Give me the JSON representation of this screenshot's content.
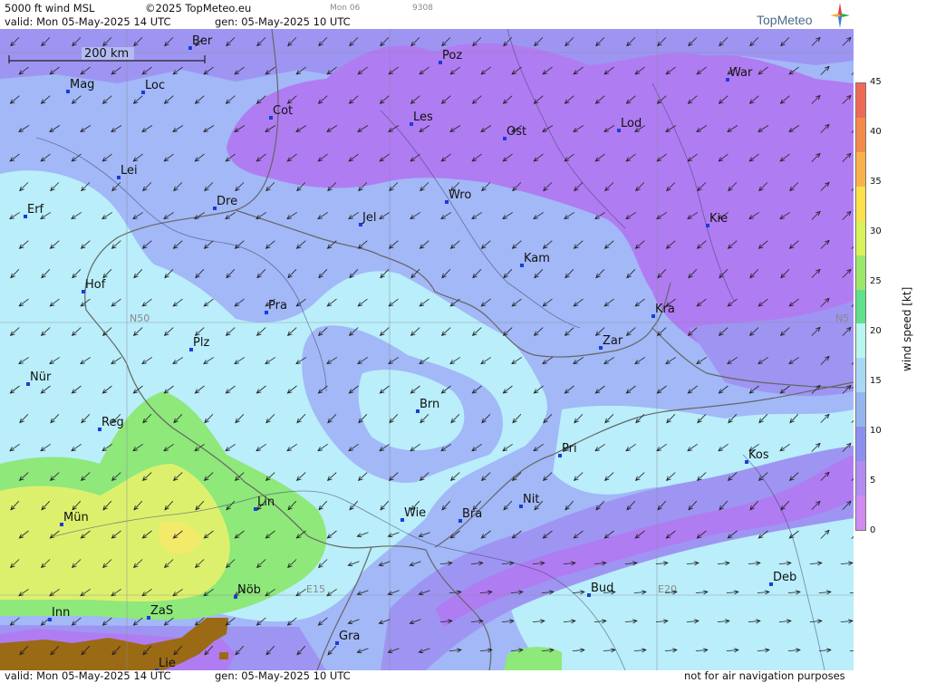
{
  "header": {
    "product": "5000 ft wind MSL",
    "copyright": "©2025 TopMeteo.eu",
    "valid_line": "valid:  Mon  05-May-2025  14 UTC",
    "gen_line": "gen:  05-May-2025 10 UTC",
    "faint_day": "Mon 06",
    "faint_code": "9308",
    "brand": "TopMeteo"
  },
  "footer": {
    "valid_line": "valid:  Mon  05-May-2025  14 UTC",
    "gen_line": "gen:  05-May-2025 10 UTC",
    "disclaimer": "not for air navigation purposes"
  },
  "scale_bar": {
    "label": "200 km"
  },
  "grid_labels": {
    "lat": "N50",
    "lat_right": "N5",
    "lon1": "E15",
    "lon2": "E20"
  },
  "cities": [
    {
      "id": "ber",
      "label": "Ber"
    },
    {
      "id": "poz",
      "label": "Poz"
    },
    {
      "id": "war",
      "label": "War"
    },
    {
      "id": "mag",
      "label": "Mag"
    },
    {
      "id": "loc",
      "label": "Loc"
    },
    {
      "id": "cot",
      "label": "Cot"
    },
    {
      "id": "les",
      "label": "Les"
    },
    {
      "id": "ost",
      "label": "Ost"
    },
    {
      "id": "lod",
      "label": "Lod"
    },
    {
      "id": "lei",
      "label": "Lei"
    },
    {
      "id": "dre",
      "label": "Dre"
    },
    {
      "id": "wro",
      "label": "Wro"
    },
    {
      "id": "erf",
      "label": "Erf"
    },
    {
      "id": "jel",
      "label": "Jel"
    },
    {
      "id": "kie",
      "label": "Kie"
    },
    {
      "id": "kam",
      "label": "Kam"
    },
    {
      "id": "hof",
      "label": "Hof"
    },
    {
      "id": "pra",
      "label": "Pra"
    },
    {
      "id": "kra",
      "label": "Kra"
    },
    {
      "id": "plz",
      "label": "Plz"
    },
    {
      "id": "zar",
      "label": "Zar"
    },
    {
      "id": "nur",
      "label": "Nür"
    },
    {
      "id": "brn",
      "label": "Brn"
    },
    {
      "id": "reg",
      "label": "Reg"
    },
    {
      "id": "pri",
      "label": "Pri"
    },
    {
      "id": "kos",
      "label": "Kos"
    },
    {
      "id": "lin",
      "label": "Lin"
    },
    {
      "id": "nit",
      "label": "Nit"
    },
    {
      "id": "mun",
      "label": "Mün"
    },
    {
      "id": "wie",
      "label": "Wie"
    },
    {
      "id": "bra",
      "label": "Bra"
    },
    {
      "id": "deb",
      "label": "Deb"
    },
    {
      "id": "nob",
      "label": "Nöb"
    },
    {
      "id": "bud",
      "label": "Bud"
    },
    {
      "id": "inn",
      "label": "Inn"
    },
    {
      "id": "zas",
      "label": "ZaS"
    },
    {
      "id": "gra",
      "label": "Gra"
    },
    {
      "id": "lie",
      "label": "Lie"
    }
  ],
  "legend": {
    "title": "wind  speed  [kt]",
    "ticks": [
      "45",
      "40",
      "35",
      "30",
      "25",
      "20",
      "15",
      "10",
      "5",
      "0"
    ],
    "colors": [
      "#ee6a55",
      "#f48b48",
      "#f9b24a",
      "#fde14b",
      "#d8f25a",
      "#9be86a",
      "#5fe08a",
      "#b8f6ee",
      "#a9d8f5",
      "#93b6f0",
      "#8c8ff0",
      "#b48bf0",
      "#d08af2"
    ]
  },
  "colors": {
    "wind_0_5": "#b07cf2",
    "wind_5_10": "#9e95f2",
    "wind_10_15": "#a2b8f7",
    "wind_15_20": "#b9eefa",
    "wind_20_25": "#8ee87a",
    "wind_25_30": "#ddf06e",
    "wind_30_35": "#f3ea6a",
    "terrain": "#9b6a14"
  }
}
